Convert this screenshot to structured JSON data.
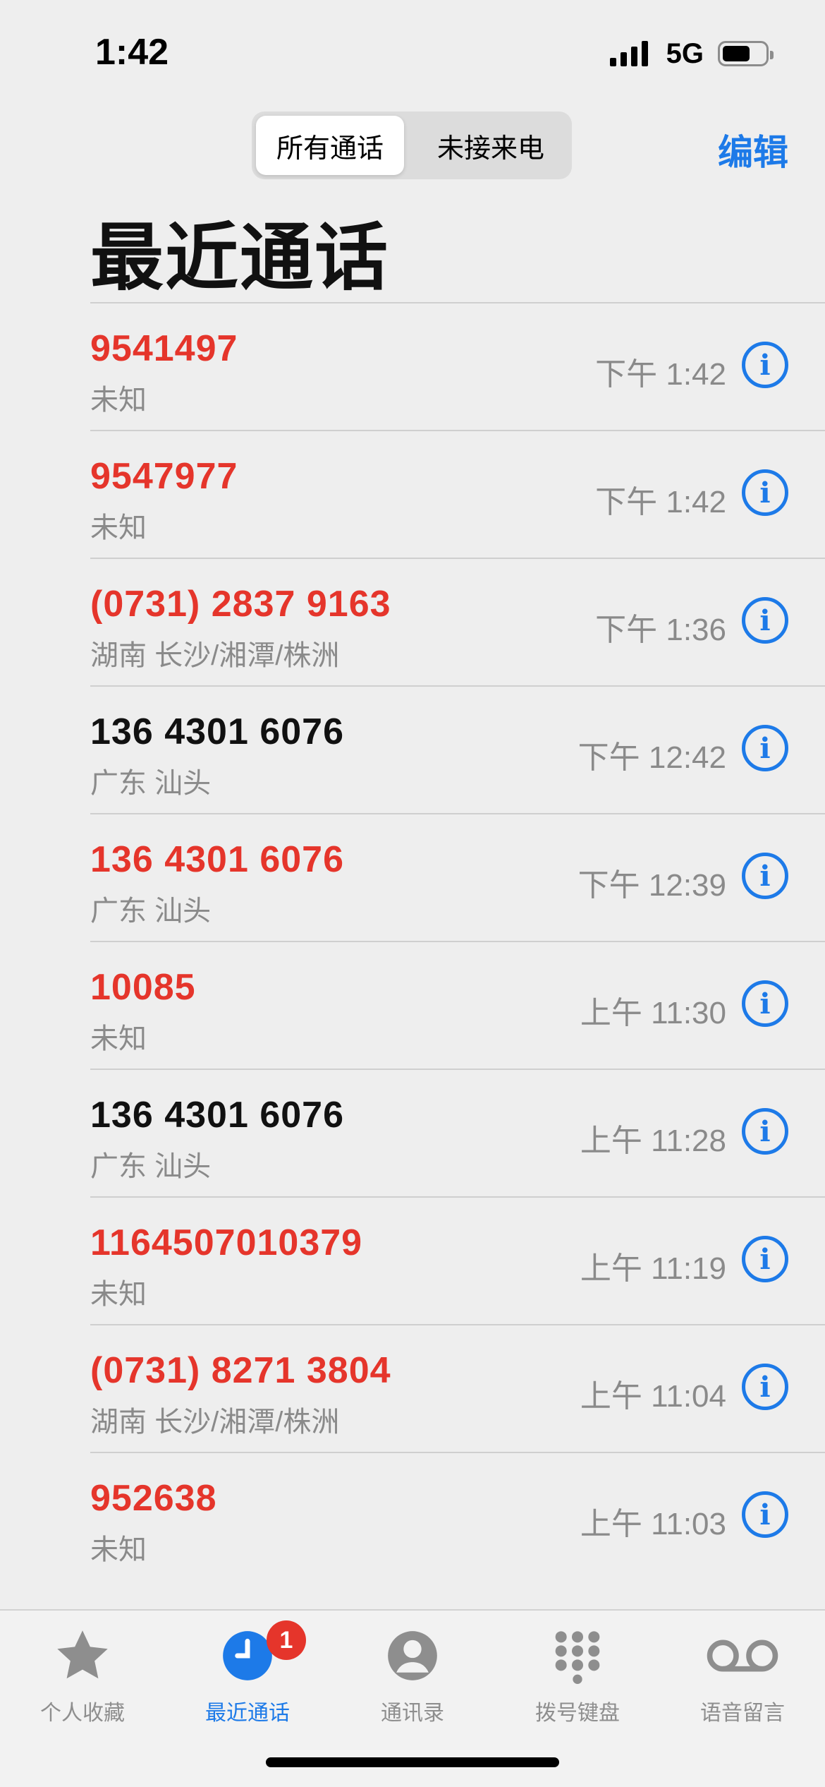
{
  "status_bar": {
    "time": "1:42",
    "network": "5G"
  },
  "segmented": {
    "all_label": "所有通话",
    "missed_label": "未接来电"
  },
  "edit_label": "编辑",
  "title": "最近通话",
  "calls": [
    {
      "number": "9541497",
      "location": "未知",
      "time": "下午 1:42",
      "missed": true
    },
    {
      "number": "9547977",
      "location": "未知",
      "time": "下午 1:42",
      "missed": true
    },
    {
      "number": "(0731) 2837 9163",
      "location": "湖南 长沙/湘潭/株洲",
      "time": "下午 1:36",
      "missed": true
    },
    {
      "number": "136 4301 6076",
      "location": "广东 汕头",
      "time": "下午 12:42",
      "missed": false
    },
    {
      "number": "136 4301 6076",
      "location": "广东 汕头",
      "time": "下午 12:39",
      "missed": true
    },
    {
      "number": "10085",
      "location": "未知",
      "time": "上午 11:30",
      "missed": true
    },
    {
      "number": "136 4301 6076",
      "location": "广东 汕头",
      "time": "上午 11:28",
      "missed": false
    },
    {
      "number": "1164507010379",
      "location": "未知",
      "time": "上午 11:19",
      "missed": true
    },
    {
      "number": "(0731) 8271 3804",
      "location": "湖南 长沙/湘潭/株洲",
      "time": "上午 11:04",
      "missed": true
    },
    {
      "number": "952638",
      "location": "未知",
      "time": "上午 11:03",
      "missed": true
    }
  ],
  "info_icon_glyph": "i",
  "tabs": [
    {
      "label": "个人收藏",
      "icon": "star-icon"
    },
    {
      "label": "最近通话",
      "icon": "clock-icon",
      "badge": "1",
      "active": true
    },
    {
      "label": "通讯录",
      "icon": "person-icon"
    },
    {
      "label": "拨号键盘",
      "icon": "keypad-icon"
    },
    {
      "label": "语音留言",
      "icon": "voicemail-icon"
    }
  ],
  "colors": {
    "accent": "#1d7ae8",
    "missed": "#e5352b",
    "secondary_text": "#8a8a8a"
  }
}
